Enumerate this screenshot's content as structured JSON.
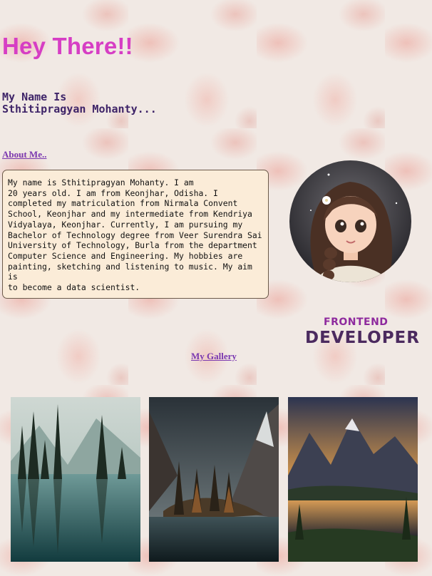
{
  "hero": {
    "title": "Hey There!!"
  },
  "intro": {
    "line1": "My Name Is",
    "line2": "Sthitipragyan Mohanty..."
  },
  "about": {
    "link_label": "About Me..",
    "text": "My name is Sthitipragyan Mohanty. I am\n20 years old. I am from Keonjhar, Odisha. I\ncompleted my matriculation from Nirmala Convent\nSchool, Keonjhar and my intermediate from Kendriya\nVidyalaya, Keonjhar. Currently, I am pursuing my\nBachelor of Technology degree from Veer Surendra Sai\nUniversity of Technology, Burla from the department\nComputer Science and Engineering. My hobbies are\npainting, sketching and listening to music. My aim is\nto become a data scientist."
  },
  "role": {
    "line1": "FRONTEND",
    "line2": "DEVELOPER"
  },
  "gallery": {
    "link_label": "My Gallery",
    "images": [
      {
        "name": "forest lake landscape"
      },
      {
        "name": "mountain lake with pines"
      },
      {
        "name": "sunset mountain lake"
      }
    ]
  },
  "colors": {
    "title": "#d63ec4",
    "name": "#3e2468",
    "link": "#7a38b0",
    "about_bg": "#fbecd8",
    "frontend": "#8e2a9e",
    "developer": "#4b2a5f"
  }
}
